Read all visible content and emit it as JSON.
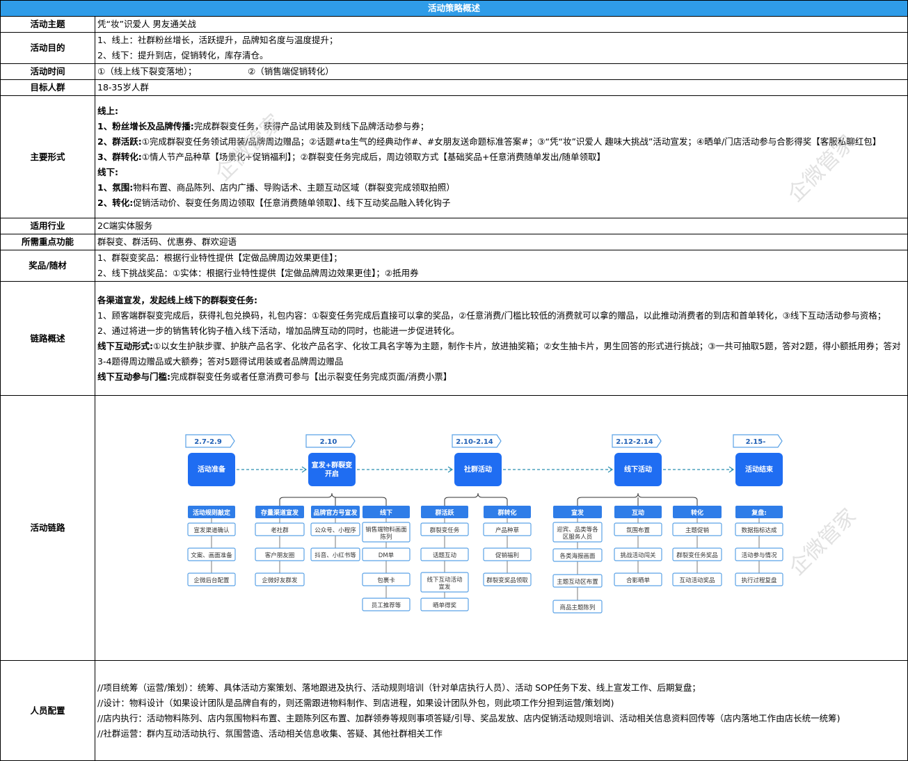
{
  "title": "活动策略概述",
  "rows": {
    "theme": {
      "label": "活动主题",
      "value": "凭“妆”识爱人 男友通关战"
    },
    "goal": {
      "label": "活动目的",
      "lines": [
        "1、线上：社群粉丝增长，活跃提升，品牌知名度与温度提升；",
        "2、线下：提升到店，促销转化，库存清仓。"
      ]
    },
    "time": {
      "label": "活动时间",
      "part1": "①（线上线下裂变落地）；",
      "part2": "②（销售端促销转化）"
    },
    "audience": {
      "label": "目标人群",
      "value": "18-35岁人群"
    },
    "form": {
      "label": "主要形式",
      "online_head": "线上:",
      "l1_bold": "1、粉丝增长及品牌传播:",
      "l1_text": "完成群裂变任务，获得产品试用装及到线下品牌活动参与券；",
      "l2_bold": "2、群活跃:",
      "l2_text": "①完成群裂变任务领试用装/品牌周边赠品；②话题#ta生气的经典动作#、#女朋友送命题标准答案#；③“凭“妆”识爱人 趣味大挑战”活动宣发；④晒单/门店活动参与合影得奖【客服私聊红包】",
      "l3_bold": "3、群转化:",
      "l3_text": "①情人节产品种草【场景化+促销福利】；②群裂变任务完成后，周边领取方式【基础奖品+任意消费随单发出/随单领取】",
      "offline_head": "线下:",
      "l4_bold": "1、氛围:",
      "l4_text": "物料布置、商品陈列、店内广播、导购话术、主题互动区域（群裂变完成领取拍照）",
      "l5_bold": "2、转化:",
      "l5_text": "促销活动价、裂变任务周边领取【任意消费随单领取】、线下互动奖品融入转化钩子"
    },
    "industry": {
      "label": "适用行业",
      "value": "2C端实体服务"
    },
    "features": {
      "label": "所需重点功能",
      "value": "群裂变、群活码、优惠券、群欢迎语"
    },
    "prize": {
      "label": "奖品/随材",
      "lines": [
        "1、群裂变奖品：根据行业特性提供【定做品牌周边效果更佳】；",
        "2、线下挑战奖品：①实体：根据行业特性提供【定做品牌周边效果更佳】；②抵用券"
      ]
    },
    "link": {
      "label": "链路概述",
      "head": "各渠道宣发，发起线上线下的群裂变任务:",
      "p1": "1、顾客端群裂变完成后，获得礼包兑换码，礼包内容：①裂变任务完成后直接可以拿的奖品，②任意消费/门槛比较低的消费就可以拿的赠品，以此推动消费者的到店和首单转化，③线下互动活动参与资格；",
      "p2": "2、通过将进一步的销售转化钩子植入线下活动，增加品牌互动的同时，也能进一步促进转化。",
      "p3_bold": "线下互动形式:",
      "p3_text": "①以女生护肤步骤、护肤产品名字、化妆产品名字、化妆工具名字等为主题，制作卡片，放进抽奖箱；②女生抽卡片，男生回答的形式进行挑战；③一共可抽取5题，答对2题，得小额抵用券；答对3-4题得周边赠品或大额券；答对5题得试用装或者品牌周边赠品",
      "p4_bold": "线下互动参与门槛:",
      "p4_text": "完成群裂变任务或者任意消费可参与【出示裂变任务完成页面/消费小票】"
    },
    "chain": {
      "label": "活动链路"
    },
    "staff": {
      "label": "人员配置",
      "lines": [
        "//项目统筹（运营/策划）：统筹、具体活动方案策划、落地跟进及执行、活动规则培训（针对单店执行人员）、活动 SOP任务下发、线上宣发工作、后期复盘；",
        "//设计：物料设计（如果设计团队是品牌自有的，则还需跟进物料制作、到店进程，如果设计团队外包，则此项工作分担到运营/策划岗)",
        "//店内执行：活动物料陈列、店内氛围物料布置、主题陈列区布置、加群领券等规则事项答疑/引导、奖品发放、店内促销活动规则培训、活动相关信息资料回传等（店内落地工作由店长统一统筹)",
        "//社群运营：群内互动活动执行、氛围营造、活动相关信息收集、答疑、其他社群相关工作"
      ]
    }
  },
  "flow": {
    "dates": [
      "2.7-2.9",
      "2.10",
      "2.10-2.14",
      "2.12-2.14",
      "2.15-"
    ],
    "stages": [
      "活动准备",
      "宣发+群裂变\n开启",
      "社群活动",
      "线下活动",
      "活动结束"
    ],
    "columns": [
      {
        "header": "活动规则敲定",
        "items": [
          "宣发渠道确认",
          "文案、画面准备",
          "企微后台配置"
        ]
      },
      {
        "header": "存量渠道宣发",
        "items": [
          "老社群",
          "客户朋友圈",
          "企微好友群发"
        ]
      },
      {
        "header": "品牌官方号宣发",
        "items": [
          "公众号、小程序",
          "抖音、小红书等"
        ]
      },
      {
        "header": "线下",
        "items": [
          "销售端物料画面\n陈列",
          "DM单",
          "包裹卡",
          "员工推荐等"
        ]
      },
      {
        "header": "群活跃",
        "items": [
          "群裂变任务",
          "话题互动",
          "线下互动活动\n宣发",
          "晒单得奖"
        ]
      },
      {
        "header": "群转化",
        "items": [
          "产品种草",
          "促销福利",
          "群裂变奖品领取"
        ]
      },
      {
        "header": "宣发",
        "items": [
          "迎宾、品类等各\n区服务人员",
          "各类海报画面",
          "主题互动区布置",
          "商品主题陈列"
        ]
      },
      {
        "header": "互动",
        "items": [
          "氛围布置",
          "挑战活动闯关",
          "合影晒单"
        ]
      },
      {
        "header": "转化",
        "items": [
          "主题促销",
          "群裂变任务奖品",
          "互动活动奖品"
        ]
      },
      {
        "header": "复盘:",
        "items": [
          "数据指标达成",
          "活动参与情况",
          "执行过程复盘"
        ]
      }
    ],
    "colors": {
      "accent": "#1f6df2",
      "box_border": "#5aa2e6",
      "header_fill": "#2f7de8"
    }
  },
  "watermark": "企微管家",
  "colors": {
    "title_bar": "#2f9ce8"
  }
}
